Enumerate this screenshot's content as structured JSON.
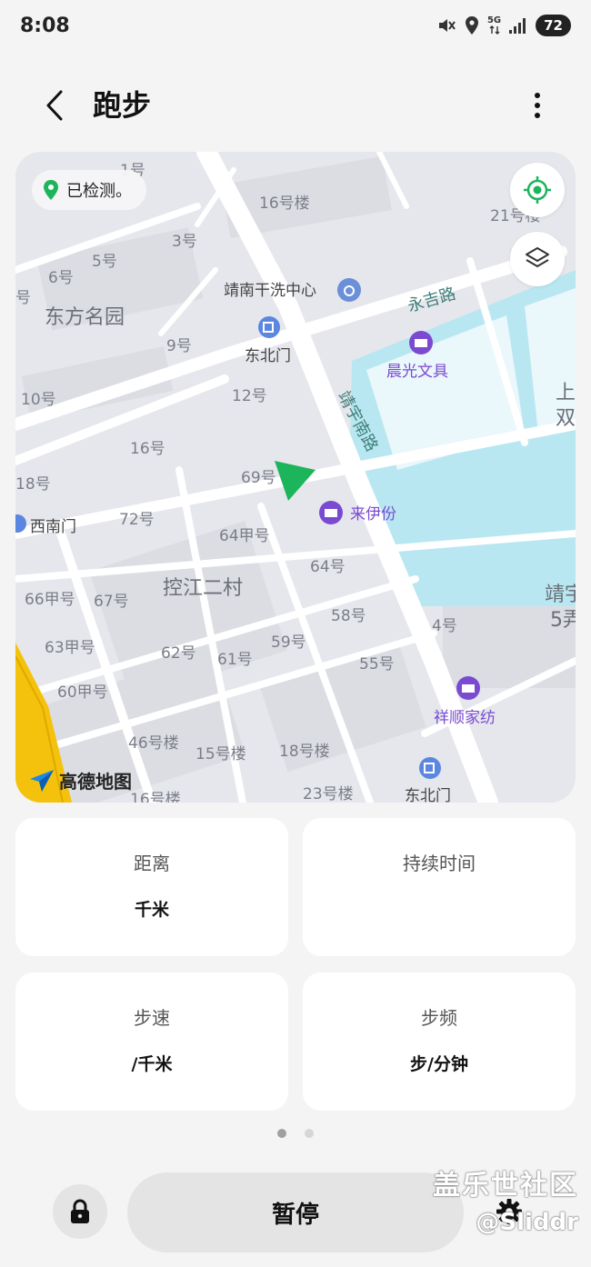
{
  "status_bar": {
    "time": "8:08",
    "network": "5G",
    "battery": "72"
  },
  "header": {
    "title": "跑步"
  },
  "map": {
    "location_status": "已检测。",
    "provider_logo": "高德地图",
    "labels": {
      "l1": "1号",
      "l2": "16号楼",
      "l3": "21号楼",
      "l4": "3号",
      "l5": "5号",
      "l6": "6号",
      "l7": "号",
      "l8": "靖南干洗中心",
      "l9": "永吉路",
      "l10": "东方名园",
      "l11": "9号",
      "l12": "东北门",
      "l13": "晨光文具",
      "l14": "上",
      "l15": "双",
      "l16": "10号",
      "l17": "12号",
      "l18": "靖宇南路",
      "l19": "16号",
      "l20": "18号",
      "l21": "69号",
      "l22": "西南门",
      "l23": "72号",
      "l24": "来伊份",
      "l25": "64甲号",
      "l26": "64号",
      "l27": "控江二村",
      "l28": "66甲号",
      "l29": "67号",
      "l30": "58号",
      "l31": "靖宇",
      "l32": "5弄",
      "l33": "4号",
      "l34": "63甲号",
      "l35": "62号",
      "l36": "61号",
      "l37": "59号",
      "l38": "55号",
      "l39": "60甲号",
      "l40": "祥顺家纺",
      "l41": "46号楼",
      "l42": "15号楼",
      "l43": "18号楼",
      "l44": "16号楼",
      "l45": "23号楼",
      "l46": "东北门"
    }
  },
  "stats": [
    {
      "label": "距离",
      "value": "千米"
    },
    {
      "label": "持续时间",
      "value": ""
    },
    {
      "label": "步速",
      "value": "/千米"
    },
    {
      "label": "步频",
      "value": "步/分钟"
    }
  ],
  "pager": {
    "count": 2,
    "active": 1
  },
  "controls": {
    "pause_label": "暂停"
  },
  "watermark": {
    "line1": "盖乐世社区",
    "line2": "@Sliddr"
  },
  "colors": {
    "accent_green": "#1db55c",
    "poi_purple": "#7a4bd1",
    "water": "#b8e7f2"
  }
}
